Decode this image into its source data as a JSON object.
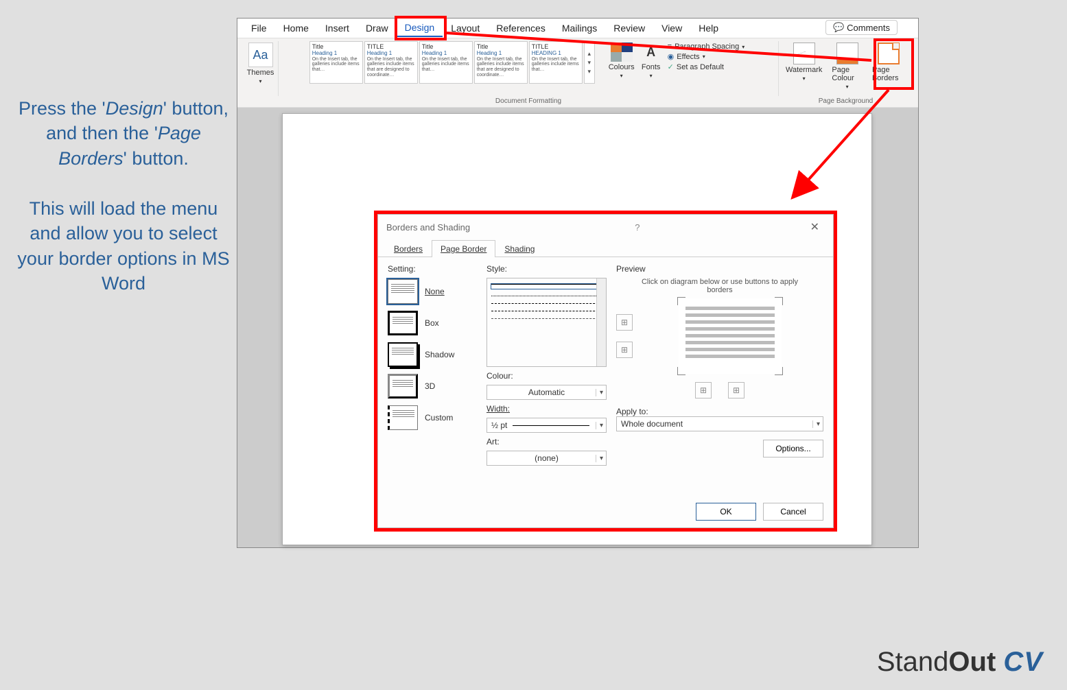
{
  "instruction": {
    "line1_pre": "Press the '",
    "line1_em": "Design",
    "line1_post": "' button, and then the '",
    "line2_em": "Page Borders",
    "line2_post": "' button.",
    "para2": "This will load the menu and allow you to select your border options in MS Word"
  },
  "ribbon": {
    "tabs": [
      "File",
      "Home",
      "Insert",
      "Draw",
      "Design",
      "Layout",
      "References",
      "Mailings",
      "Review",
      "View",
      "Help"
    ],
    "active_tab": "Design",
    "comments": "Comments",
    "themes": "Themes",
    "gallery": [
      {
        "t1": "Title",
        "t2": "Heading 1",
        "t3": "On the Insert tab, the galleries include items that…"
      },
      {
        "t1": "TITLE",
        "t2": "Heading 1",
        "t3": "On the Insert tab, the galleries include items that are designed to coordinate…"
      },
      {
        "t1": "Title",
        "t2": "Heading 1",
        "t3": "On the Insert tab, the galleries include items that…"
      },
      {
        "t1": "Title",
        "t2": "Heading 1",
        "t3": "On the Insert tab, the galleries include items that are designed to coordinate…"
      },
      {
        "t1": "TITLE",
        "t2": "HEADING 1",
        "t3": "On the Insert tab, the galleries include items that…"
      }
    ],
    "colours": "Colours",
    "fonts": "Fonts",
    "para_spacing": "Paragraph Spacing",
    "effects": "Effects",
    "set_default": "Set as Default",
    "watermark": "Watermark",
    "page_colour": "Page Colour",
    "page_borders": "Page Borders",
    "group_docfmt": "Document Formatting",
    "group_pagebg": "Page Background"
  },
  "dialog": {
    "title": "Borders and Shading",
    "tabs": {
      "borders": "Borders",
      "page_border": "Page Border",
      "shading": "Shading"
    },
    "setting_label": "Setting:",
    "settings": {
      "none": "None",
      "box": "Box",
      "shadow": "Shadow",
      "threed": "3D",
      "custom": "Custom"
    },
    "style_label": "Style:",
    "colour_label": "Colour:",
    "colour_value": "Automatic",
    "width_label": "Width:",
    "width_value": "½ pt",
    "art_label": "Art:",
    "art_value": "(none)",
    "preview_label": "Preview",
    "preview_hint": "Click on diagram below or use buttons to apply borders",
    "apply_label": "Apply to:",
    "apply_value": "Whole document",
    "options": "Options...",
    "ok": "OK",
    "cancel": "Cancel"
  },
  "logo": {
    "part1": "Stand",
    "part2": "Out",
    "part3": "CV"
  }
}
